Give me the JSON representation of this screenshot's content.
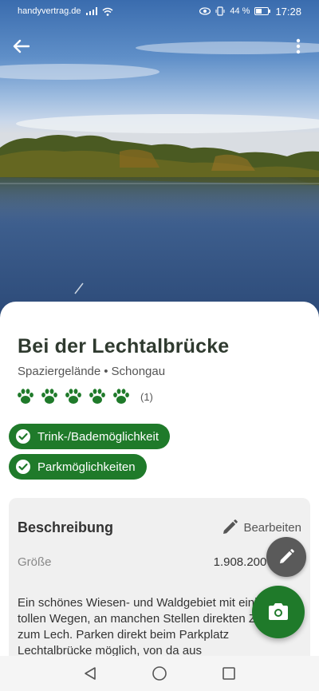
{
  "statusbar": {
    "carrier": "handyvertrag.de",
    "battery": "44 %",
    "time": "17:28",
    "icons": [
      "signal-icon",
      "wifi-icon",
      "eye-icon",
      "vibrate-icon",
      "battery-icon"
    ]
  },
  "header": {
    "back_icon": "back-arrow-icon",
    "menu_icon": "more-vert-icon"
  },
  "place": {
    "title": "Bei der Lechtalbrücke",
    "category": "Spaziergelände",
    "separator": "•",
    "location": "Schongau",
    "rating": 5,
    "rating_max": 5,
    "rating_count": "(1)"
  },
  "features": [
    {
      "label": "Trink-/Bademöglichkeit",
      "icon": "check-circle-icon"
    },
    {
      "label": "Parkmöglichkeiten",
      "icon": "check-circle-icon"
    }
  ],
  "description_card": {
    "title": "Beschreibung",
    "edit_label": "Bearbeiten",
    "size_label": "Größe",
    "size_value": "1.908.200 m²",
    "text": "Ein schönes Wiesen- und Waldgebiet mit einigen tollen Wegen, an manchen Stellen direkten Zugang zum Lech. Parken direkt beim Parkplatz Lechtalbrücke möglich, von da aus"
  },
  "fabs": {
    "edit_icon": "pencil-icon",
    "camera_icon": "camera-icon"
  },
  "colors": {
    "accent_green": "#1f7a2a",
    "fab_gray": "#5a5a5a",
    "title_dark": "#2f3a2f"
  }
}
